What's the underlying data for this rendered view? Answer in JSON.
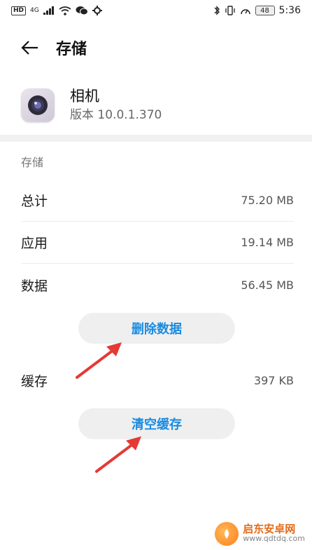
{
  "status_bar": {
    "left_badge": "HD",
    "network": "4G",
    "battery": "48",
    "time": "5:36"
  },
  "header": {
    "title": "存储"
  },
  "app": {
    "name": "相机",
    "version": "版本 10.0.1.370"
  },
  "storage": {
    "section_title": "存储",
    "rows": [
      {
        "label": "总计",
        "value": "75.20 MB"
      },
      {
        "label": "应用",
        "value": "19.14 MB"
      },
      {
        "label": "数据",
        "value": "56.45 MB"
      }
    ],
    "delete_data_button": "删除数据",
    "cache_label": "缓存",
    "cache_value": "397 KB",
    "clear_cache_button": "清空缓存"
  },
  "watermark": {
    "title": "启东安卓网",
    "url": "www.qdtdq.com"
  },
  "colors": {
    "accent": "#1a8be0",
    "arrow": "#e53935",
    "button_bg": "#efefef"
  }
}
